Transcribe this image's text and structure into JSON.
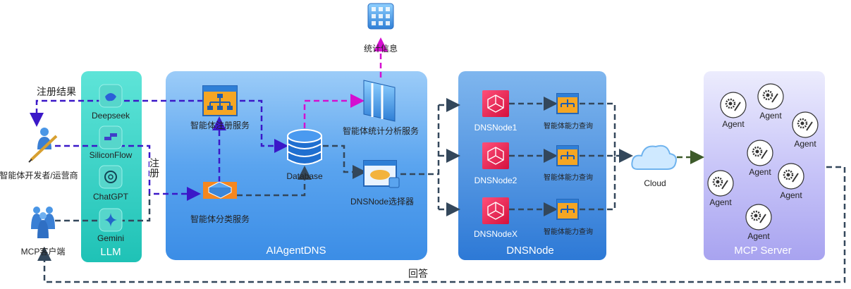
{
  "groups": {
    "llm": "LLM",
    "aiagentdns": "AIAgentDNS",
    "dnsnode": "DNSNode",
    "mcp_server": "MCP Server"
  },
  "llm_models": [
    "Deepseek",
    "SiliconFlow",
    "ChatGPT",
    "Gemini"
  ],
  "actors": {
    "developer": "智能体开发者/运营商",
    "mcp_client": "MCP客户端"
  },
  "services": {
    "register": "智能体注册服务",
    "classify": "智能体分类服务",
    "database": "Database",
    "stats_service": "智能体统计分析服务",
    "selector": "DNSNode选择器",
    "stats_info": "统计信息"
  },
  "dns_nodes": [
    {
      "name": "DNSNode1",
      "query": "智能体能力查询"
    },
    {
      "name": "DNSNode2",
      "query": "智能体能力查询"
    },
    {
      "name": "DNSNodeX",
      "query": "智能体能力查询"
    }
  ],
  "cloud": "Cloud",
  "agent_label": "Agent",
  "edge_labels": {
    "register_result": "注册结果",
    "register": "注册",
    "answer": "回答"
  },
  "colors": {
    "purple_dashed": "#3b18c8",
    "magenta_dashed": "#d40fd0",
    "dark_dashed": "#33475b",
    "llm_panel": "#36d1c4",
    "aiagentdns_panel": "#3d92ea",
    "dnsnode_panel": "#3382de",
    "mcp_panel": "#b9b5f5"
  }
}
